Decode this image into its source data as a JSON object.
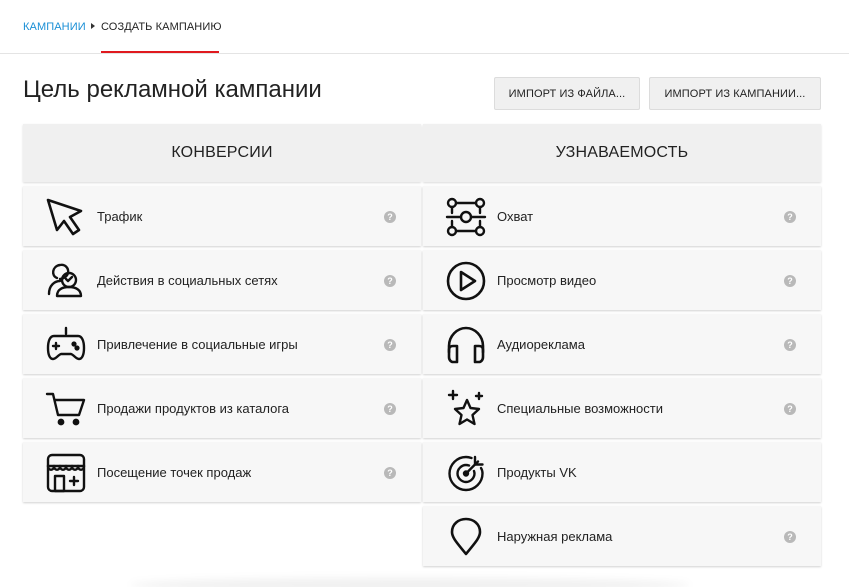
{
  "breadcrumb": {
    "root": "КАМПАНИИ",
    "current": "СОЗДАТЬ КАМПАНИЮ"
  },
  "header": {
    "title": "Цель рекламной кампании",
    "import_file": "ИМПОРТ ИЗ ФАЙЛА...",
    "import_campaign": "ИМПОРТ ИЗ КАМПАНИИ..."
  },
  "conversions": {
    "title": "КОНВЕРСИИ",
    "items": [
      {
        "label": "Трафик",
        "icon": "cursor-click-icon",
        "help": "?"
      },
      {
        "label": "Действия в социальных сетях",
        "icon": "social-users-icon",
        "help": "?"
      },
      {
        "label": "Привлечение в социальные игры",
        "icon": "gamepad-icon",
        "help": "?"
      },
      {
        "label": "Продажи продуктов из каталога",
        "icon": "shopping-cart-icon",
        "help": "?"
      },
      {
        "label": "Посещение точек продаж",
        "icon": "store-icon",
        "help": "?"
      }
    ]
  },
  "awareness": {
    "title": "УЗНАВАЕМОСТЬ",
    "items": [
      {
        "label": "Охват",
        "icon": "reach-network-icon",
        "help": "?"
      },
      {
        "label": "Просмотр видео",
        "icon": "play-video-icon",
        "help": "?"
      },
      {
        "label": "Аудиореклама",
        "icon": "headphones-icon",
        "help": "?"
      },
      {
        "label": "Специальные возможности",
        "icon": "special-stars-icon",
        "help": "?"
      },
      {
        "label": "Продукты VK",
        "icon": "target-icon",
        "help": ""
      },
      {
        "label": "Наружная реклама",
        "icon": "map-pin-icon",
        "help": "?"
      }
    ]
  }
}
